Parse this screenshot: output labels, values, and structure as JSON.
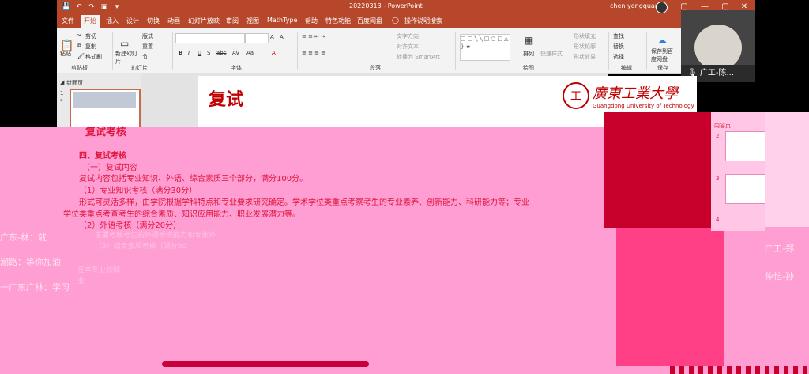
{
  "titlebar": {
    "doc_title": "20220313 - PowerPoint",
    "user": "chen yongquan",
    "minimize": "—",
    "restore": "▢",
    "close": "✕"
  },
  "tabs": [
    "文件",
    "开始",
    "插入",
    "设计",
    "切换",
    "动画",
    "幻灯片放映",
    "审阅",
    "视图",
    "MathType",
    "帮助",
    "特色功能",
    "百度网盘"
  ],
  "tell_me": "操作说明搜索",
  "ribbon": {
    "clipboard": {
      "paste": "粘贴",
      "cut": "剪切",
      "copy": "复制",
      "format_painter": "格式刷",
      "label": "剪贴板"
    },
    "slides": {
      "new_slide": "新建幻灯片",
      "layout": "版式",
      "reset": "重置",
      "section": "节",
      "label": "幻灯片"
    },
    "font": {
      "bold": "B",
      "italic": "I",
      "underline": "U",
      "strike": "S",
      "shadow": "abc",
      "spacing": "AV",
      "case": "Aa",
      "grow": "A",
      "shrink": "A",
      "label": "字体"
    },
    "paragraph": {
      "text_direction": "文字方向",
      "align_text": "对齐文本",
      "smartart": "转换为 SmartArt",
      "label": "段落"
    },
    "drawing": {
      "arrange": "排列",
      "quick_styles": "快速样式",
      "fill": "形状填充",
      "outline": "形状轮廓",
      "effects": "形状效果",
      "label": "绘图"
    },
    "editing": {
      "find": "查找",
      "replace": "替换",
      "select": "选择",
      "label": "编辑"
    },
    "save": {
      "save_to": "保存到百度网盘",
      "label": "保存"
    }
  },
  "video": {
    "name": "广工-陈..."
  },
  "thumbnails": {
    "section": "封面页",
    "slide_num": "1",
    "star": "*"
  },
  "slide": {
    "title": "复试",
    "uni_cn": "廣東工業大學",
    "uni_en": "Guangdong University of Technology",
    "logo": "工"
  },
  "slide_body": {
    "partial_heading": "复试考核",
    "heading": "四、复试考核",
    "sub1": "（一）复试内容",
    "line1": "复试内容包括专业知识、外语、综合素质三个部分，满分100分。",
    "line2": "（1）专业知识考核（满分30分）",
    "line3": "形式可灵活多样，由学院根据学科特点和专业要求研究确定。学术学位类重点考察考生的专业素养、创新能力、科研能力等；专业",
    "line4": "学位类重点考查考生的综合素质、知识应用能力、职业发展潜力等。",
    "line5": "（2）外语考核（满分20分）",
    "faint1": "主要考核考生的外语听说能力和专业外",
    "faint2": "（3）综合素质考核（满分50",
    "faint3": "在本专业领域",
    "faint4": "业",
    "chat1": "广东-林：就",
    "chat2": "潮路：等你加油",
    "chat3": "一广东广林：学习",
    "chat4": "广工-郑",
    "chat5": "仲恺-孙"
  },
  "right_pane": {
    "section": "内容页",
    "n2": "2",
    "n3": "3",
    "n4": "4",
    "star": "*"
  }
}
